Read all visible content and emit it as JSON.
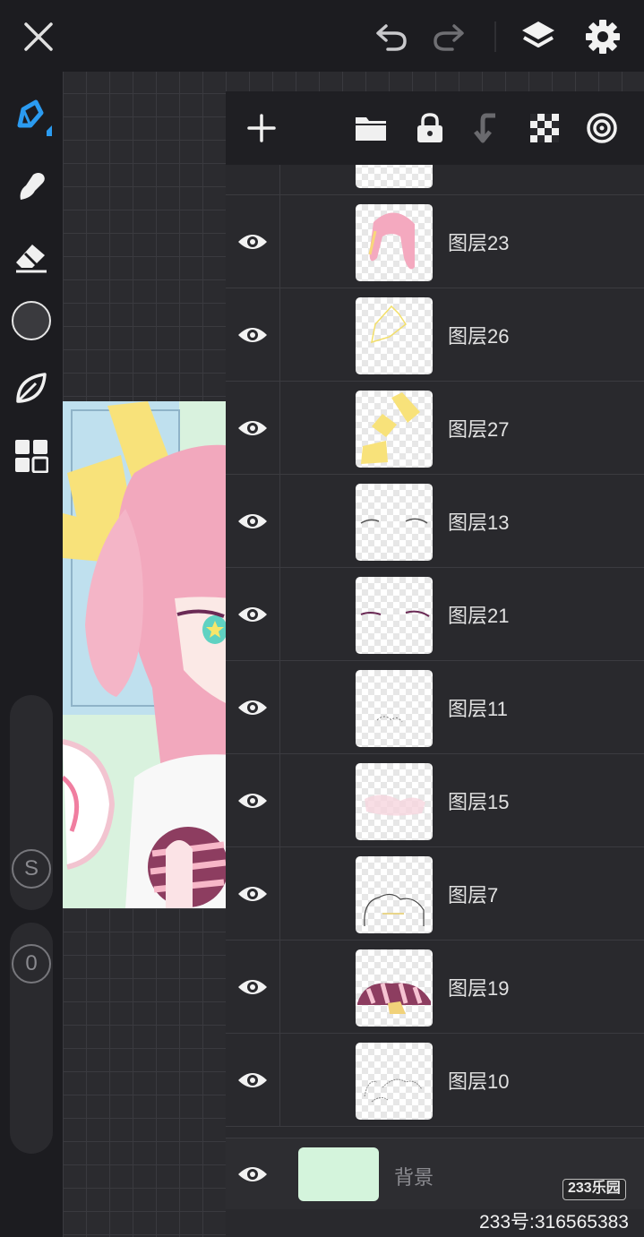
{
  "topbar": {
    "icons": [
      "close-icon",
      "undo-icon",
      "redo-icon",
      "layers-icon",
      "settings-icon"
    ]
  },
  "left_toolbar": {
    "tools": [
      "pen-icon",
      "smudge-icon",
      "eraser-icon",
      "color-swatch",
      "leaf-icon",
      "grid-icon"
    ],
    "size_label": "S",
    "opacity_label": "0"
  },
  "layer_panel": {
    "toolbar_icons": [
      "add-layer-icon",
      "folder-icon",
      "lock-icon",
      "merge-down-icon",
      "transparency-icon",
      "blend-icon"
    ],
    "layers": [
      {
        "name": "图层23",
        "thumb": "hair"
      },
      {
        "name": "图层26",
        "thumb": "yellow-outline"
      },
      {
        "name": "图层27",
        "thumb": "yellow-fill"
      },
      {
        "name": "图层13",
        "thumb": "eyelid"
      },
      {
        "name": "图层21",
        "thumb": "eyelid-purple"
      },
      {
        "name": "图层11",
        "thumb": "sketch"
      },
      {
        "name": "图层15",
        "thumb": "pink-blush"
      },
      {
        "name": "图层7",
        "thumb": "outline-shape"
      },
      {
        "name": "图层19",
        "thumb": "striped-ball"
      },
      {
        "name": "图层10",
        "thumb": "sketch-lines"
      }
    ],
    "background": {
      "name": "背景",
      "color": "#d4f4dc"
    }
  },
  "colors": {
    "accent": "#2b9bf0",
    "current_color": "#3a3a3e"
  },
  "watermark": {
    "badge": "233乐园",
    "text": "233号:316565383"
  }
}
